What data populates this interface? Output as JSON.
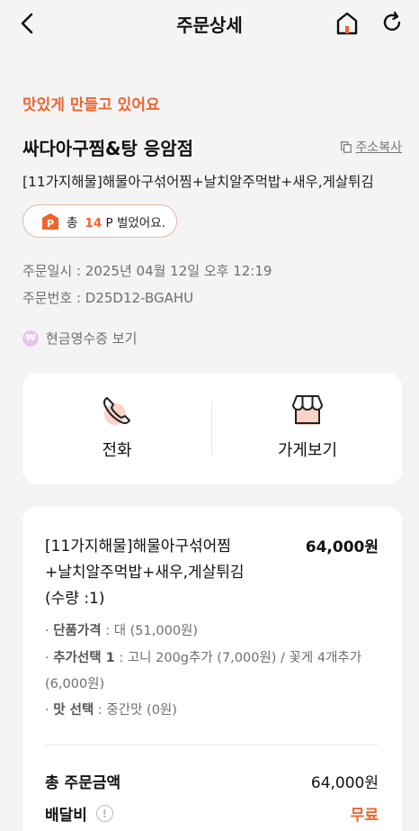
{
  "header": {
    "title": "주문상세",
    "icons": [
      "chevron-left-icon",
      "home-icon",
      "refresh-icon"
    ]
  },
  "order": {
    "status": "맛있게 만들고 있어요",
    "store_name": "싸다아구찜&탕 응암점",
    "copy_address_label": "주소복사",
    "menu_summary": "[11가지해물]해물아구섞어찜+날치알주먹밥+새우,게살튀김",
    "points": {
      "prefix": "총",
      "amount": "14",
      "suffix": "P 벌었어요.",
      "icon": "point-p-icon"
    },
    "ordered_at": "주문일시 : 2025년 04월 12일 오후 12:19",
    "order_number": "주문번호 : D25D12-BGAHU",
    "cash_receipt_label": "현금영수증 보기",
    "cash_receipt_icon_text": "₩"
  },
  "actions": {
    "call_label": "전화",
    "store_label": "가게보기"
  },
  "items": [
    {
      "name_lines": [
        "[11가지해물]해물아구섞어찜",
        "+날치알주먹밥+새우,게살튀김",
        "(수량 :1)"
      ],
      "price": "64,000원",
      "options": [
        {
          "label": "단품가격",
          "value": "대 (51,000원)"
        },
        {
          "label": "추가선택 1",
          "value": "고니 200g추가 (7,000원) / 꽃게 4개추가 (6,000원)"
        },
        {
          "label": "맛 선택",
          "value": "중간맛 (0원)"
        }
      ]
    }
  ],
  "summary": {
    "total_label": "총 주문금액",
    "total_value": "64,000원",
    "delivery_label": "배달비",
    "delivery_value": "무료"
  },
  "colors": {
    "accent": "#f0642e",
    "background": "#f4f4f5",
    "card": "#ffffff",
    "muted_text": "#6f6f6f"
  }
}
